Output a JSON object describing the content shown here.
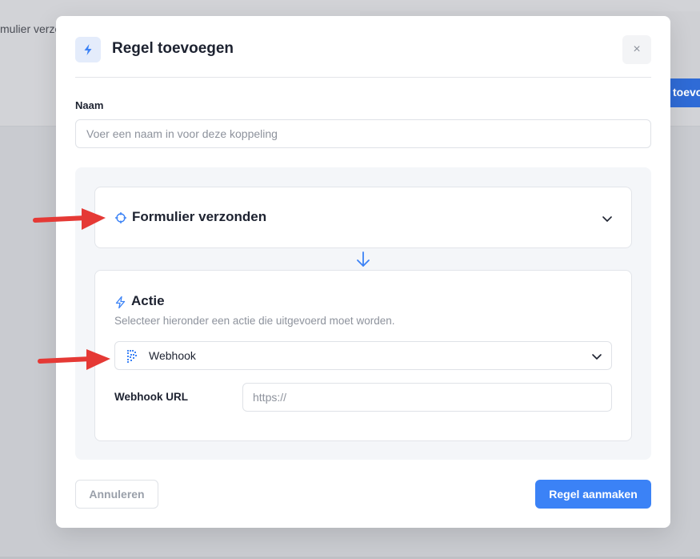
{
  "background": {
    "left_text": "mulier verzo",
    "right_button_text": "toevo"
  },
  "modal": {
    "title": "Regel toevoegen",
    "title_icon": "bolt-icon",
    "close_label": "×"
  },
  "name_field": {
    "label": "Naam",
    "placeholder": "Voer een naam in voor deze koppeling",
    "value": ""
  },
  "trigger": {
    "icon": "crosshair-icon",
    "title": "Formulier verzonden"
  },
  "action": {
    "icon": "bolt-icon",
    "title": "Actie",
    "description": "Selecteer hieronder een actie die uitgevoerd moet worden.",
    "selected": "Webhook",
    "selected_icon": "webhook-icon",
    "webhook_url_label": "Webhook URL",
    "webhook_url_placeholder": "https://"
  },
  "footer": {
    "cancel_label": "Annuleren",
    "submit_label": "Regel aanmaken"
  },
  "colors": {
    "accent": "#3b82f6",
    "annotation_arrow": "#e53935"
  }
}
